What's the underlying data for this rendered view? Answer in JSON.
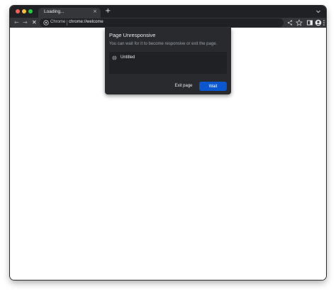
{
  "window": {
    "traffic_lights": [
      "close",
      "minimize",
      "maximize"
    ]
  },
  "tabs": [
    {
      "label": "Loading...",
      "close_glyph": "×"
    }
  ],
  "new_tab_glyph": "+",
  "toolbar": {
    "back_glyph": "←",
    "forward_glyph": "→",
    "stop_glyph": "✕",
    "site_chip_label": "Chrome",
    "url": "chrome://welcome",
    "icons": [
      "share-icon",
      "bookmark-star-icon",
      "side-panel-icon",
      "profile-avatar-icon",
      "kebab-menu-icon"
    ]
  },
  "dialog": {
    "title": "Page Unresponsive",
    "message": "You can wait for it to become responsive or exit the page.",
    "pages": [
      {
        "name": "Untitled",
        "icon": "globe-icon"
      }
    ],
    "exit_label": "Exit page",
    "wait_label": "Wait"
  },
  "colors": {
    "titlebar": "#202124",
    "toolbar": "#35363a",
    "dialog_bg": "#292a2d",
    "primary_button": "#0b57d0"
  }
}
